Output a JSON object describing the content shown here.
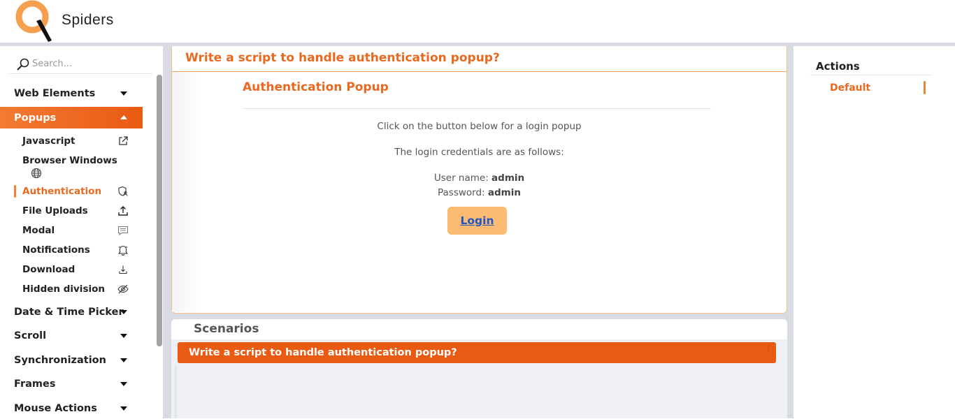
{
  "brand": {
    "logo_text": "Spiders",
    "colors": {
      "accent": "#e8691f",
      "accent_dark": "#e95a12",
      "button": "#fcbb72",
      "link": "#2454c4",
      "separator": "#d9dbe2"
    }
  },
  "search": {
    "placeholder": "Search...",
    "icon": "search-icon"
  },
  "sidebar": {
    "menus": [
      {
        "label": "Web Elements",
        "icon": "chevron-down-icon"
      },
      {
        "label": "Popups",
        "icon": "chevron-up-icon",
        "active": true
      },
      {
        "label": "Date & Time Picker",
        "icon": "chevron-down-icon"
      },
      {
        "label": "Scroll",
        "icon": "chevron-down-icon"
      },
      {
        "label": "Synchronization",
        "icon": "chevron-down-icon"
      },
      {
        "label": "Frames",
        "icon": "chevron-down-icon"
      },
      {
        "label": "Mouse Actions",
        "icon": "chevron-down-icon"
      }
    ],
    "popups_items": [
      {
        "label": "Javascript",
        "icon": "external-link-icon"
      },
      {
        "label": "Browser Windows",
        "icon": "globe-icon"
      },
      {
        "label": "Authentication",
        "icon": "shield-user-icon",
        "active": true
      },
      {
        "label": "File Uploads",
        "icon": "upload-icon"
      },
      {
        "label": "Modal",
        "icon": "message-icon"
      },
      {
        "label": "Notifications",
        "icon": "bell-icon"
      },
      {
        "label": "Download",
        "icon": "download-icon"
      },
      {
        "label": "Hidden division",
        "icon": "eye-off-icon"
      }
    ]
  },
  "main": {
    "heading": "Write a script to handle authentication popup?",
    "section_title": "Authentication Popup",
    "instruction": "Click on the button below for a login popup",
    "credentials_intro": "The login credentials are as follows:",
    "username_label": "User name:",
    "username_value": "admin",
    "password_label": "Password:",
    "password_value": "admin",
    "login_button": "Login"
  },
  "scenarios": {
    "title": "Scenarios",
    "items": [
      {
        "label": "Write a script to handle authentication popup?"
      }
    ]
  },
  "actions": {
    "title": "Actions",
    "items": [
      {
        "label": "Default",
        "active": true
      }
    ]
  }
}
